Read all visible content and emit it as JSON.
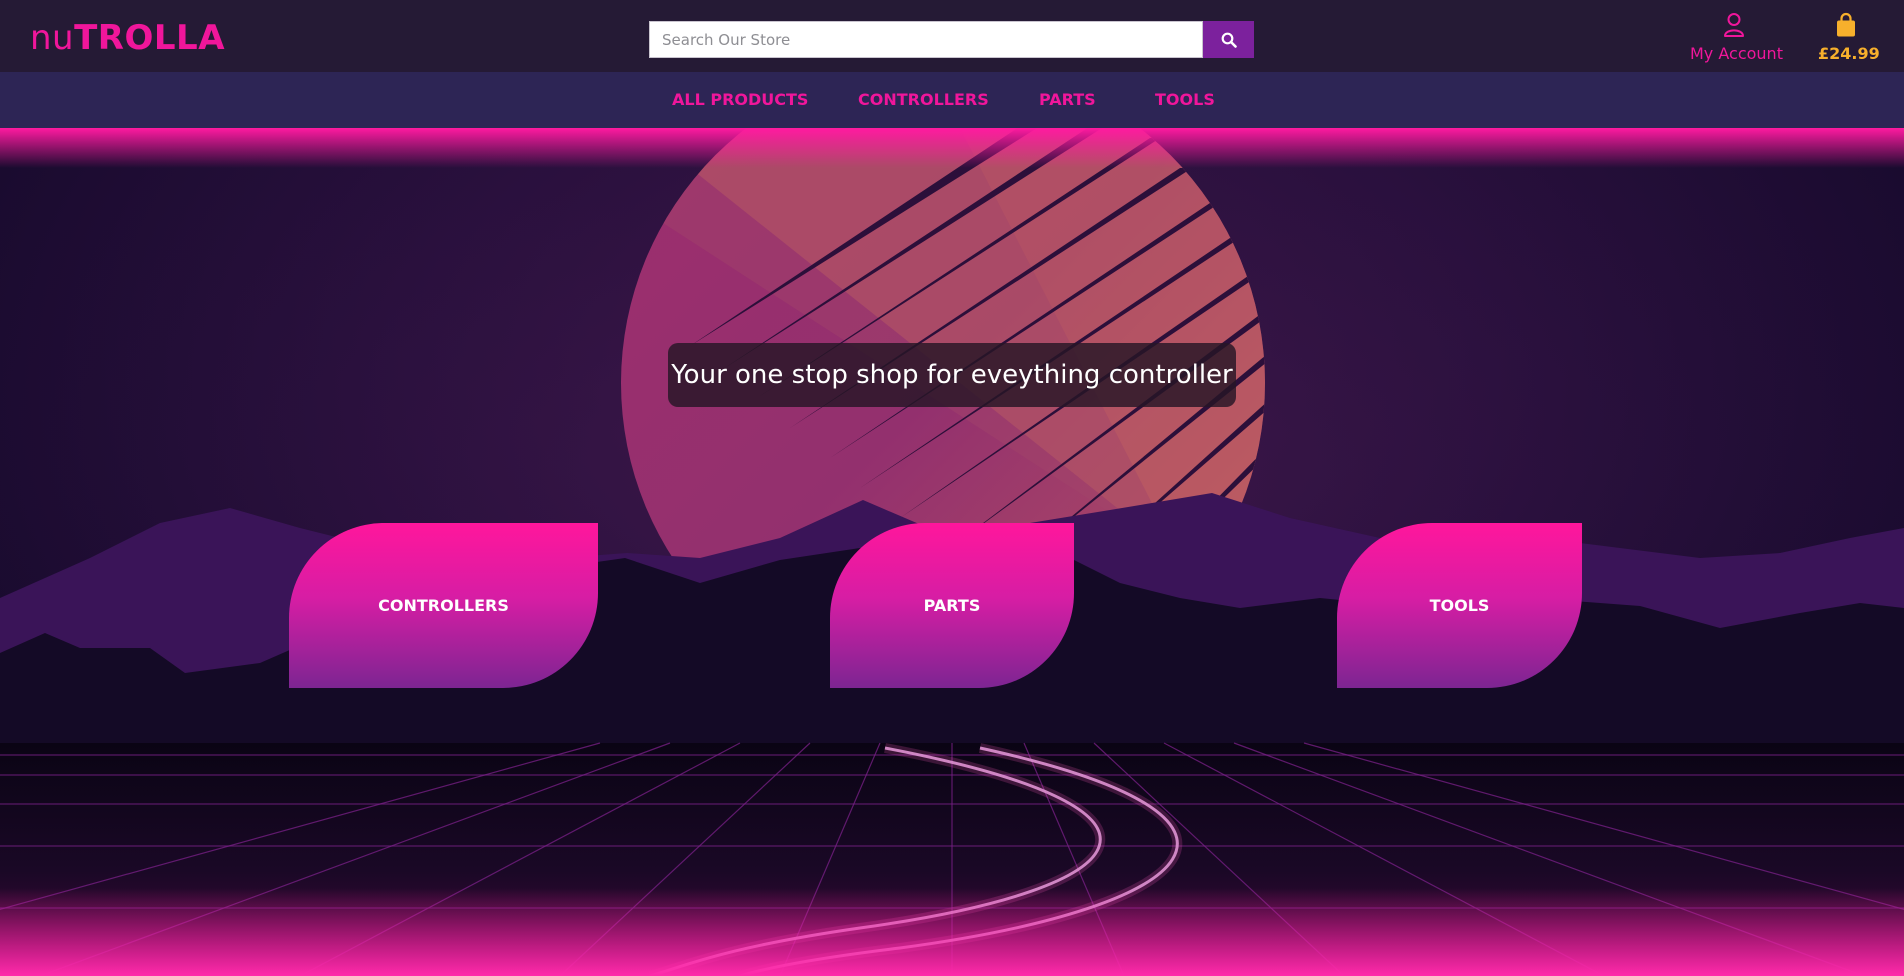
{
  "header": {
    "logo_prefix": "nu",
    "logo_main": "TROLLA",
    "search": {
      "placeholder": "Search Our Store",
      "value": "",
      "button_icon": "search-icon"
    },
    "account": {
      "label": "My Account",
      "icon": "user-icon"
    },
    "cart": {
      "total": "£24.99",
      "icon": "shopping-bag-icon"
    }
  },
  "nav": {
    "items": [
      {
        "label": "ALL PRODUCTS"
      },
      {
        "label": "CONTROLLERS"
      },
      {
        "label": "PARTS"
      },
      {
        "label": "TOOLS"
      }
    ]
  },
  "hero": {
    "tagline": "Your one stop shop for eveything controller",
    "categories": [
      {
        "label": "CONTROLLERS"
      },
      {
        "label": "PARTS"
      },
      {
        "label": "TOOLS"
      }
    ]
  },
  "colors": {
    "brand_pink": "#f0169b",
    "brand_purple": "#7c219d",
    "header_bg": "#251a35",
    "nav_bg": "#2d2555",
    "cart_gold": "#f7b02c"
  }
}
